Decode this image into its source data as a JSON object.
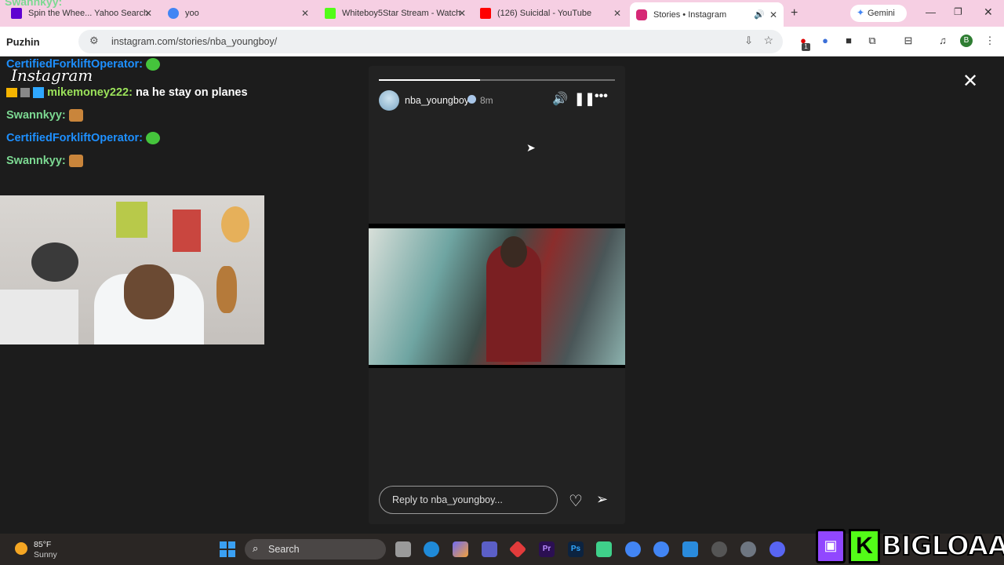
{
  "browser": {
    "tabs": [
      {
        "label": "Spin the Whee... Yahoo Search",
        "favicon_color": "#5f01d1",
        "icon": "yahoo-icon"
      },
      {
        "label": "yoo",
        "favicon_color": "#4285f4",
        "icon": "google-icon"
      },
      {
        "label": "Whiteboy5Star Stream - Watch",
        "favicon_color": "#53fc18",
        "icon": "kick-icon"
      },
      {
        "label": "(126) Suicidal - YouTube",
        "favicon_color": "#ff0000",
        "icon": "youtube-icon"
      },
      {
        "label": "Stories • Instagram",
        "favicon_color": "#d62976",
        "icon": "instagram-icon"
      }
    ],
    "new_tab_label": "+",
    "gemini_label": "Gemini",
    "url": "instagram.com/stories/nba_youngboy/",
    "profile_initial": "B",
    "extension_badge": "1"
  },
  "overlay": {
    "puzhin_label": "Puzhin",
    "instagram_wordmark": "Instagram",
    "chat_top_user": "Swannkyy:",
    "chat": [
      {
        "user": "CertifiedForkliftOperator:",
        "message": "",
        "user_color": "#1e90ff"
      },
      {
        "user": "mikemoney222:",
        "message": "na he stay on planes",
        "user_color": "#9be25a"
      },
      {
        "user": "Swannkyy:",
        "message": "",
        "user_color": "#7cd992"
      },
      {
        "user": "CertifiedForkliftOperator:",
        "message": "",
        "user_color": "#1e90ff"
      },
      {
        "user": "Swannkyy:",
        "message": "",
        "user_color": "#7cd992"
      }
    ],
    "brand_name": "BIGLOAAF",
    "brand_k": "K"
  },
  "story": {
    "username": "nba_youngboy",
    "time_ago": "8m",
    "progress": 0.43,
    "reply_placeholder": "Reply to nba_youngboy...",
    "controls": {
      "volume_icon": "speaker-icon",
      "pause_icon": "pause-icon",
      "more_icon": "more-icon"
    }
  },
  "taskbar": {
    "weather_temp": "85°F",
    "weather_condition": "Sunny",
    "search_placeholder": "Search"
  }
}
